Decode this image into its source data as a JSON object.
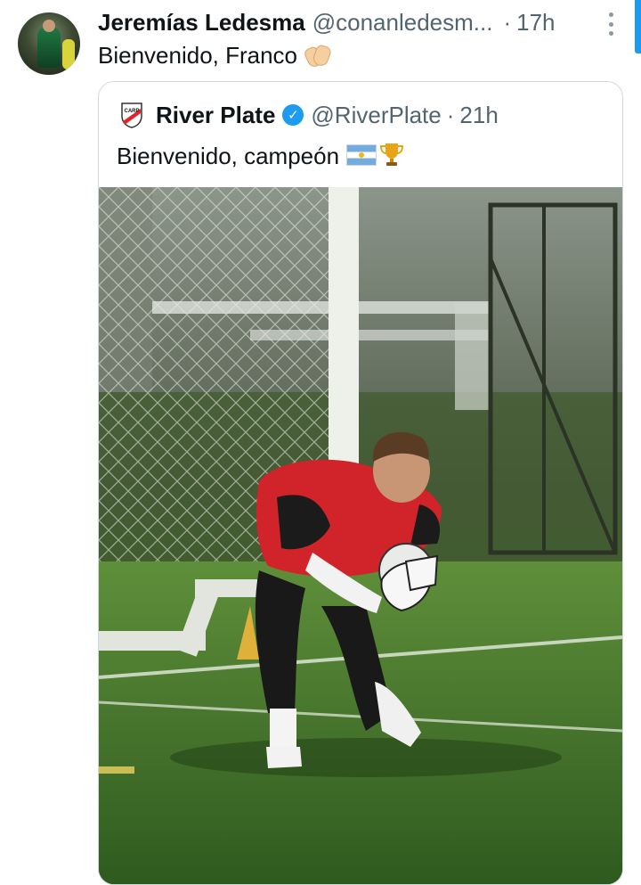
{
  "tweet": {
    "author_name": "Jeremías Ledesma",
    "author_handle": "@conanledesm...",
    "separator": "·",
    "time": "17h",
    "text": "Bienvenido, Franco",
    "emoji_icon": "clapping-hands-icon"
  },
  "quoted_tweet": {
    "author_name": "River Plate",
    "verified": true,
    "author_handle": "@RiverPlate",
    "separator": "·",
    "time": "21h",
    "text": "Bienvenido, campeón",
    "emoji_icons": [
      "argentina-flag-icon",
      "trophy-icon"
    ],
    "image_description_icon": "goalkeeper-photo"
  },
  "colors": {
    "text_primary": "#0f1419",
    "text_secondary": "#536471",
    "accent": "#1d9bf0",
    "border": "#cfd9de"
  }
}
